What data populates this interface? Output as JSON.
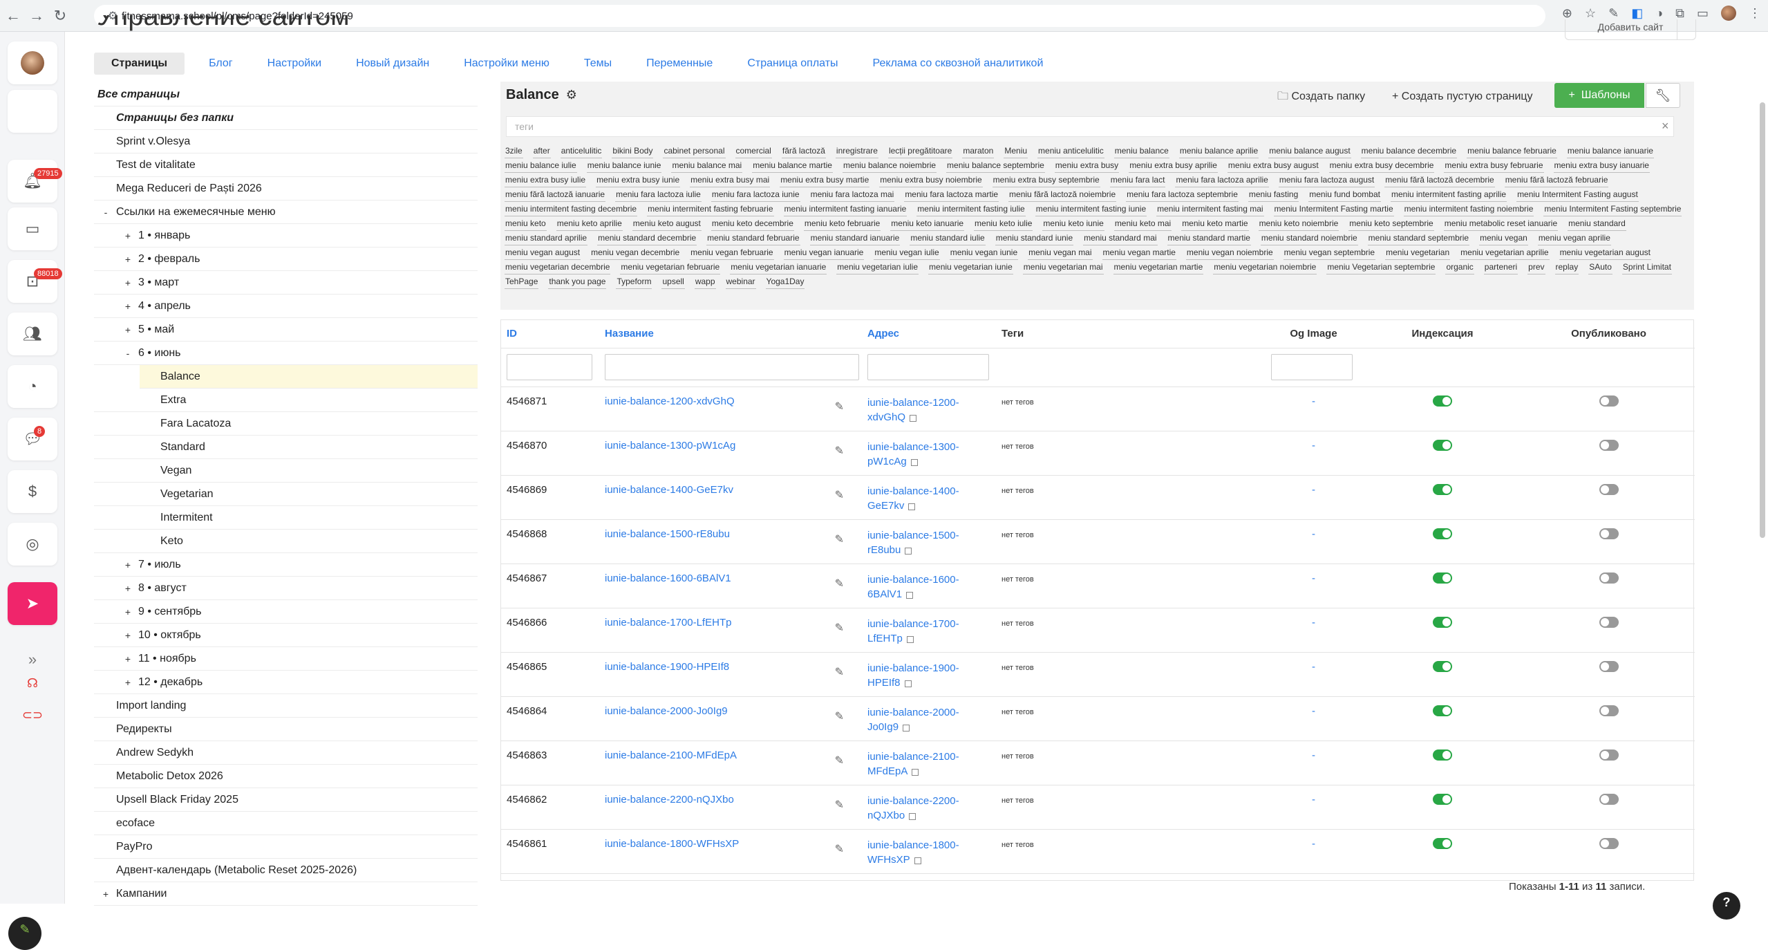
{
  "browser": {
    "url": "fitnessmama.school/pl/cms/page?folderId=245059"
  },
  "page": {
    "title": "Управление сайтом",
    "header_button": "Добавить сайт"
  },
  "tabs": [
    "Страницы",
    "Блог",
    "Настройки",
    "Новый дизайн",
    "Настройки меню",
    "Темы",
    "Переменные",
    "Страница оплаты",
    "Реклама со сквозной аналитикой"
  ],
  "sidebar": {
    "badges": {
      "notifications": "27915",
      "tasks": "88018",
      "messages": "8"
    }
  },
  "tree": [
    {
      "label": "Все страницы",
      "style": "bi",
      "toggle": ""
    },
    {
      "label": "Страницы без папки",
      "style": "bi",
      "toggle": ""
    },
    {
      "label": "Sprint v.Olesya",
      "toggle": ""
    },
    {
      "label": "Test de vitalitate",
      "toggle": ""
    },
    {
      "label": "Mega Reduceri de Paști 2026",
      "toggle": ""
    },
    {
      "label": "Ссылки на ежемесячные меню",
      "toggle": "-"
    },
    {
      "label": "1 • январь",
      "toggle": "+"
    },
    {
      "label": "2 • февраль",
      "toggle": "+"
    },
    {
      "label": "3 • март",
      "toggle": "+"
    },
    {
      "label": "4 • апрель",
      "toggle": "+"
    },
    {
      "label": "5 • май",
      "toggle": "+"
    },
    {
      "label": "6 • июнь",
      "toggle": "-"
    },
    {
      "label": "Balance",
      "toggle": "",
      "selected": true
    },
    {
      "label": "Extra",
      "toggle": ""
    },
    {
      "label": "Fara Lacatoza",
      "toggle": ""
    },
    {
      "label": "Standard",
      "toggle": ""
    },
    {
      "label": "Vegan",
      "toggle": ""
    },
    {
      "label": "Vegetarian",
      "toggle": ""
    },
    {
      "label": "Intermitent",
      "toggle": ""
    },
    {
      "label": "Keto",
      "toggle": ""
    },
    {
      "label": "7 • июль",
      "toggle": "+"
    },
    {
      "label": "8 • август",
      "toggle": "+"
    },
    {
      "label": "9 • сентябрь",
      "toggle": "+"
    },
    {
      "label": "10 • октябрь",
      "toggle": "+"
    },
    {
      "label": "11 • ноябрь",
      "toggle": "+"
    },
    {
      "label": "12 • декабрь",
      "toggle": "+"
    },
    {
      "label": "Import landing",
      "toggle": ""
    },
    {
      "label": "Редиректы",
      "toggle": ""
    },
    {
      "label": "Andrew Sedykh",
      "toggle": ""
    },
    {
      "label": "Metabolic Detox 2026",
      "toggle": ""
    },
    {
      "label": "Upsell Black Friday 2025",
      "toggle": ""
    },
    {
      "label": "ecoface",
      "toggle": ""
    },
    {
      "label": "PayPro",
      "toggle": ""
    },
    {
      "label": "Адвент-календарь (Metabolic Reset 2025-2026)",
      "toggle": ""
    },
    {
      "label": "Кампании",
      "toggle": "+"
    }
  ],
  "panel": {
    "title": "Balance",
    "create_folder": "Создать папку",
    "create_empty": "Создать пустую страницу",
    "templates": "Шаблоны",
    "tags_placeholder": "теги",
    "tags": [
      "3zile",
      "after",
      "anticelulitic",
      "bikini Body",
      "cabinet personal",
      "comercial",
      "fără lactoză",
      "inregistrare",
      "lecții pregătitoare",
      "maraton",
      "Meniu",
      "meniu anticelulitic",
      "meniu balance",
      "meniu balance aprilie",
      "meniu balance august",
      "meniu balance decembrie",
      "meniu balance februarie",
      "meniu balance ianuarie",
      "meniu balance iulie",
      "meniu balance iunie",
      "meniu balance mai",
      "meniu balance martie",
      "meniu balance noiembrie",
      "meniu balance septembrie",
      "meniu extra busy",
      "meniu extra busy aprilie",
      "meniu extra busy august",
      "meniu extra busy decembrie",
      "meniu extra busy februarie",
      "meniu extra busy ianuarie",
      "meniu extra busy iulie",
      "meniu extra busy iunie",
      "meniu extra busy mai",
      "meniu extra busy martie",
      "meniu extra busy noiembrie",
      "meniu extra busy septembrie",
      "meniu fara lact",
      "meniu fara lactoza aprilie",
      "meniu fara lactoza august",
      "meniu fără lactoză decembrie",
      "meniu fără lactoză februarie",
      "meniu fără lactoză ianuarie",
      "meniu fara lactoza iulie",
      "meniu fara lactoza iunie",
      "meniu fara lactoza mai",
      "meniu fara lactoza martie",
      "meniu fără lactoză noiembrie",
      "meniu fara lactoza septembrie",
      "meniu fasting",
      "meniu fund bombat",
      "meniu intermitent fasting aprilie",
      "meniu Intermitent Fasting august",
      "meniu intermitent fasting decembrie",
      "meniu intermitent fasting februarie",
      "meniu intermitent fasting ianuarie",
      "meniu intermitent fasting iulie",
      "meniu intermitent fasting iunie",
      "meniu intermitent fasting mai",
      "meniu Intermitent Fasting martie",
      "meniu intermitent fasting noiembrie",
      "meniu Intermitent Fasting septembrie",
      "meniu keto",
      "meniu keto aprilie",
      "meniu keto august",
      "meniu keto decembrie",
      "meniu keto februarie",
      "meniu keto ianuarie",
      "meniu keto iulie",
      "meniu keto iunie",
      "meniu keto mai",
      "meniu keto martie",
      "meniu keto noiembrie",
      "meniu keto septembrie",
      "meniu metabolic reset ianuarie",
      "meniu standard",
      "meniu standard aprilie",
      "meniu standard decembrie",
      "meniu standard februarie",
      "meniu standard ianuarie",
      "meniu standard iulie",
      "meniu standard iunie",
      "meniu standard mai",
      "meniu standard martie",
      "meniu standard noiembrie",
      "meniu standard septembrie",
      "meniu vegan",
      "meniu vegan aprilie",
      "meniu vegan august",
      "meniu vegan decembrie",
      "meniu vegan februarie",
      "meniu vegan ianuarie",
      "meniu vegan iulie",
      "meniu vegan iunie",
      "meniu vegan mai",
      "meniu vegan martie",
      "meniu vegan noiembrie",
      "meniu vegan septembrie",
      "meniu vegetarian",
      "meniu vegetarian aprilie",
      "meniu vegetarian august",
      "meniu vegetarian decembrie",
      "meniu vegetarian februarie",
      "meniu vegetarian ianuarie",
      "meniu vegetarian iulie",
      "meniu vegetarian iunie",
      "meniu vegetarian mai",
      "meniu vegetarian martie",
      "meniu vegetarian noiembrie",
      "meniu Vegetarian septembrie",
      "organic",
      "parteneri",
      "prev",
      "replay",
      "SAuto",
      "Sprint Limitat",
      "TehPage",
      "thank you page",
      "Typeform",
      "upsell",
      "wapp",
      "webinar",
      "Yoga1Day"
    ]
  },
  "table": {
    "headers": {
      "id": "ID",
      "name": "Название",
      "address": "Адрес",
      "tags": "Теги",
      "og": "Og Image",
      "index": "Индексация",
      "published": "Опубликовано"
    },
    "rows": [
      {
        "id": "4546871",
        "name": "iunie-balance-1200-xdvGhQ",
        "addr1": "iunie-balance-1200-",
        "addr2": "xdvGhQ",
        "tags": "нет тегов",
        "og": "-",
        "indexed": true,
        "published": false
      },
      {
        "id": "4546870",
        "name": "iunie-balance-1300-pW1cAg",
        "addr1": "iunie-balance-1300-",
        "addr2": "pW1cAg",
        "tags": "нет тегов",
        "og": "-",
        "indexed": true,
        "published": false
      },
      {
        "id": "4546869",
        "name": "iunie-balance-1400-GeE7kv",
        "addr1": "iunie-balance-1400-",
        "addr2": "GeE7kv",
        "tags": "нет тегов",
        "og": "-",
        "indexed": true,
        "published": false
      },
      {
        "id": "4546868",
        "name": "iunie-balance-1500-rE8ubu",
        "addr1": "iunie-balance-1500-",
        "addr2": "rE8ubu",
        "tags": "нет тегов",
        "og": "-",
        "indexed": true,
        "published": false
      },
      {
        "id": "4546867",
        "name": "iunie-balance-1600-6BAlV1",
        "addr1": "iunie-balance-1600-",
        "addr2": "6BAlV1",
        "tags": "нет тегов",
        "og": "-",
        "indexed": true,
        "published": false
      },
      {
        "id": "4546866",
        "name": "iunie-balance-1700-LfEHTp",
        "addr1": "iunie-balance-1700-",
        "addr2": "LfEHTp",
        "tags": "нет тегов",
        "og": "-",
        "indexed": true,
        "published": false
      },
      {
        "id": "4546865",
        "name": "iunie-balance-1900-HPEIf8",
        "addr1": "iunie-balance-1900-",
        "addr2": "HPEIf8",
        "tags": "нет тегов",
        "og": "-",
        "indexed": true,
        "published": false
      },
      {
        "id": "4546864",
        "name": "iunie-balance-2000-Jo0Ig9",
        "addr1": "iunie-balance-2000-",
        "addr2": "Jo0Ig9",
        "tags": "нет тегов",
        "og": "-",
        "indexed": true,
        "published": false
      },
      {
        "id": "4546863",
        "name": "iunie-balance-2100-MFdEpA",
        "addr1": "iunie-balance-2100-",
        "addr2": "MFdEpA",
        "tags": "нет тегов",
        "og": "-",
        "indexed": true,
        "published": false
      },
      {
        "id": "4546862",
        "name": "iunie-balance-2200-nQJXbo",
        "addr1": "iunie-balance-2200-",
        "addr2": "nQJXbo",
        "tags": "нет тегов",
        "og": "-",
        "indexed": true,
        "published": false
      },
      {
        "id": "4546861",
        "name": "iunie-balance-1800-WFHsXP",
        "addr1": "iunie-balance-1800-",
        "addr2": "WFHsXP",
        "tags": "нет тегов",
        "og": "-",
        "indexed": true,
        "published": false
      }
    ],
    "footer": {
      "prefix": "Показаны ",
      "range": "1-11",
      "mid": " из ",
      "total": "11",
      "suffix": " записи."
    }
  }
}
